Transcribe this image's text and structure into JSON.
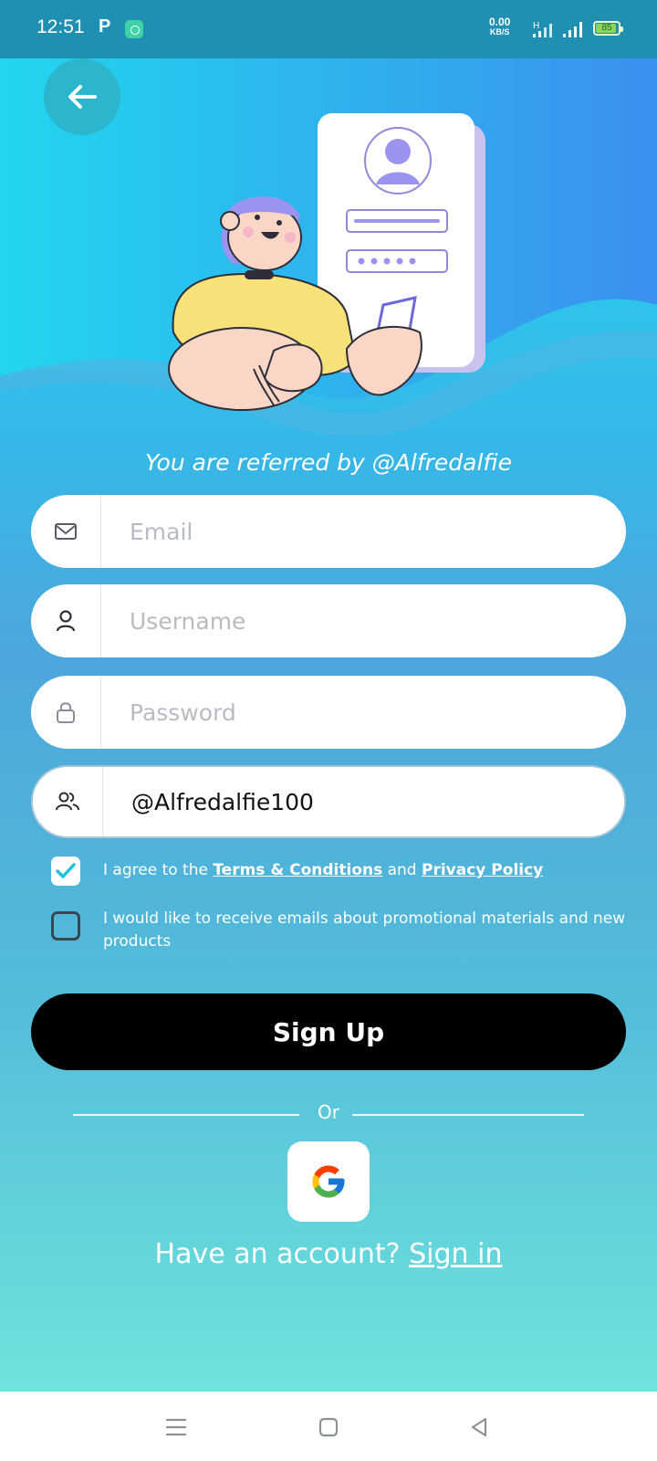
{
  "status_bar": {
    "time": "12:51",
    "app_icon_letter": "P",
    "net_speed": "0.00",
    "net_speed_unit": "KB/S",
    "network_type": "H",
    "battery": "85"
  },
  "referral_text": "You are referred by @Alfredalfie",
  "form": {
    "email_placeholder": "Email",
    "username_placeholder": "Username",
    "password_placeholder": "Password",
    "referral_value": "@Alfredalfie100"
  },
  "agreements": {
    "terms_prefix": "I agree to the ",
    "terms_link": "Terms & Conditions",
    "terms_and": " and ",
    "privacy_link": "Privacy Policy",
    "terms_checked": true,
    "promo_text": "I would like to receive emails about promotional materials and new products",
    "promo_checked": false
  },
  "signup_label": "Sign Up",
  "divider_label": "Or",
  "have_account_text": "Have an account? ",
  "sign_in_link": "Sign in",
  "colors": {
    "accent": "#2bb6cd",
    "button": "#000000",
    "gradient_top": "#24d6ee",
    "gradient_bottom": "#6ee3dc"
  },
  "icons": [
    "back-arrow-icon",
    "mail-icon",
    "user-icon",
    "lock-icon",
    "users-icon",
    "check-icon",
    "google-icon",
    "menu-icon",
    "home-square-icon",
    "back-triangle-icon"
  ]
}
